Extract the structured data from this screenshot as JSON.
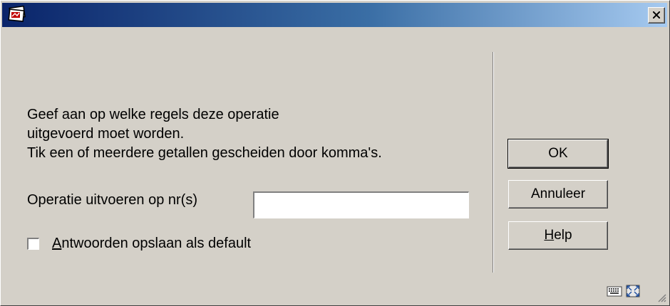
{
  "window": {
    "title": "",
    "app_icon": "stack-documents-icon",
    "close_label": "close-icon"
  },
  "prompt": {
    "line1": "Geef aan op welke regels deze operatie",
    "line2": "uitgevoerd moet  worden.",
    "line3": "Tik een of meerdere getallen gescheiden door komma's."
  },
  "form": {
    "operation_label": "Operatie uitvoeren op nr(s)",
    "operation_value": "",
    "save_default_label_first": "A",
    "save_default_label_rest": "ntwoorden opslaan als default",
    "save_default_checked": false
  },
  "buttons": {
    "ok": "OK",
    "cancel": "Annuleer",
    "help_first": "H",
    "help_rest": "elp"
  },
  "status_icons": [
    "keyboard-icon",
    "maximize-icon",
    "resize-grip-icon"
  ]
}
